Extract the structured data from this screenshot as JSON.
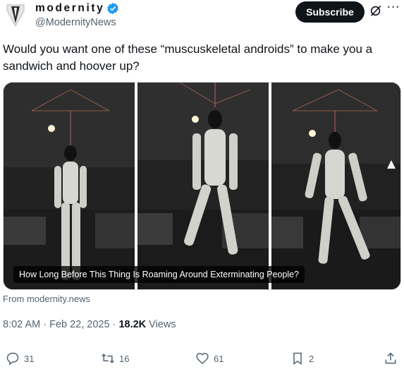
{
  "author": {
    "display_name": "modernity",
    "handle": "@ModernityNews",
    "verified_color": "#1d9bf0"
  },
  "header": {
    "subscribe_label": "Subscribe"
  },
  "tweet": {
    "text": "Would you want one of these “muscuskeletal androids” to make you a sandwich and hoover up?",
    "media_caption": "How Long Before This Thing Is Roaming Around Exterminating People?",
    "source": "From modernity.news",
    "time": "8:02 AM · Feb 22, 2025 · ",
    "views_count": "18.2K",
    "views_label": " Views"
  },
  "actions": {
    "replies": "31",
    "reposts": "16",
    "likes": "61",
    "bookmarks": "2"
  },
  "icons": {
    "avatar": "modernity-logo-icon",
    "verified": "verified-badge-icon",
    "grok": "grok-icon",
    "more": "more-icon",
    "reply": "reply-icon",
    "repost": "repost-icon",
    "like": "like-icon",
    "bookmark": "bookmark-icon",
    "share": "share-icon"
  }
}
